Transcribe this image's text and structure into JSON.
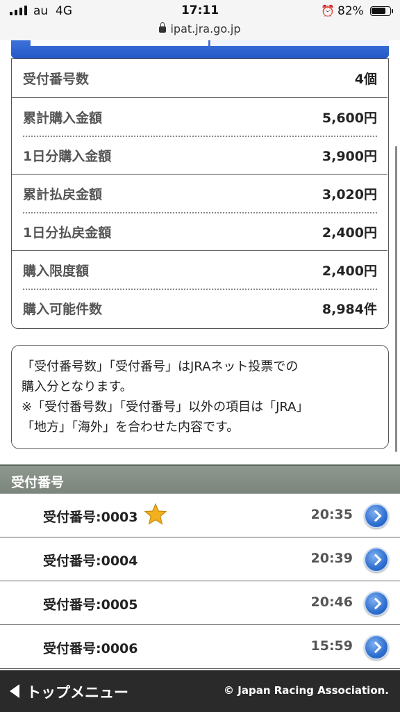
{
  "status_bar": {
    "carrier": "au",
    "network": "4G",
    "time": "17:11",
    "alarm_icon": "alarm-clock-icon",
    "battery_percent": "82%",
    "battery_level": 0.82
  },
  "address_bar": {
    "url": "ipat.jra.go.jp"
  },
  "summary": {
    "rows": [
      {
        "label": "受付番号数",
        "value": "4個"
      },
      {
        "label": "累計購入金額",
        "value": "5,600円"
      },
      {
        "label": "1日分購入金額",
        "value": "3,900円"
      },
      {
        "label": "累計払戻金額",
        "value": "3,020円"
      },
      {
        "label": "1日分払戻金額",
        "value": "2,400円"
      },
      {
        "label": "購入限度額",
        "value": "2,400円"
      },
      {
        "label": "購入可能件数",
        "value": "8,984件"
      }
    ]
  },
  "note": {
    "line1": "「受付番号数」「受付番号」はJRAネット投票での",
    "line2": "購入分となります。",
    "line3": "※「受付番号数」「受付番号」以外の項目は「JRA」",
    "line4": "「地方」「海外」を合わせた内容です。"
  },
  "receipts": {
    "header": "受付番号",
    "items": [
      {
        "label": "受付番号:0003",
        "time": "20:35",
        "starred": true
      },
      {
        "label": "受付番号:0004",
        "time": "20:39",
        "starred": false
      },
      {
        "label": "受付番号:0005",
        "time": "20:46",
        "starred": false
      },
      {
        "label": "受付番号:0006",
        "time": "15:59",
        "starred": false
      }
    ]
  },
  "footer": {
    "menu_label": "トップメニュー",
    "copyright": "© Japan Racing Association."
  },
  "colors": {
    "accent_blue": "#2458c6",
    "section_header_gray": "#838c83",
    "footer_dark": "#2a2a2a",
    "star_gold": "#f2b01e"
  }
}
